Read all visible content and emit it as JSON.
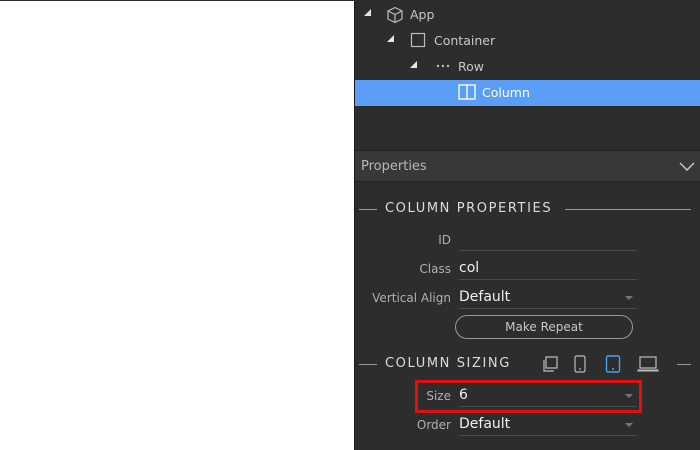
{
  "tree": {
    "items": [
      {
        "label": "App"
      },
      {
        "label": "Container"
      },
      {
        "label": "Row"
      },
      {
        "label": "Column"
      }
    ]
  },
  "properties": {
    "header": "Properties",
    "column_properties": {
      "title": "COLUMN PROPERTIES",
      "fields": {
        "id_label": "ID",
        "id_value": "",
        "class_label": "Class",
        "class_value": "col",
        "valign_label": "Vertical Align",
        "valign_value": "Default"
      },
      "make_repeat": "Make Repeat"
    },
    "column_sizing": {
      "title": "COLUMN SIZING",
      "devices": [
        "copy-icon",
        "phone-icon",
        "tablet-icon",
        "laptop-icon"
      ],
      "active_device": "tablet-icon",
      "fields": {
        "size_label": "Size",
        "size_value": "6",
        "order_label": "Order",
        "order_value": "Default"
      }
    }
  },
  "colors": {
    "panel_bg": "#2d2d2d",
    "selected": "#5b9ef7",
    "highlight": "#e01010",
    "active_device": "#4a9ff5"
  }
}
